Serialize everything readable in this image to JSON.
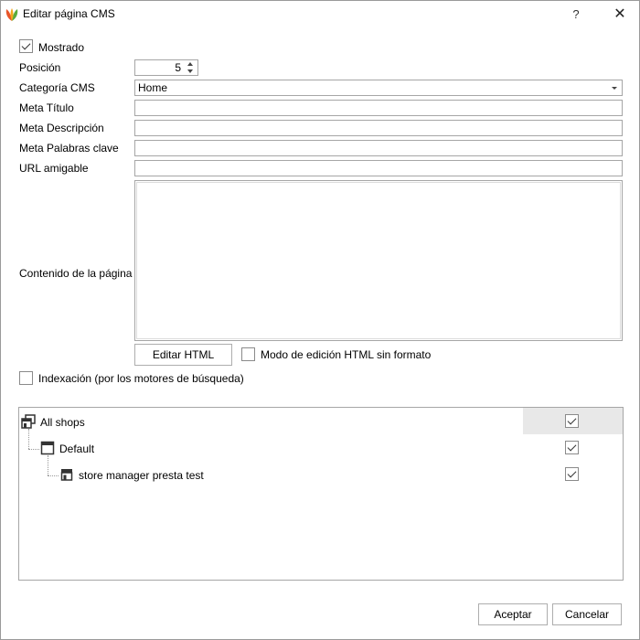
{
  "window": {
    "title": "Editar página CMS",
    "help_label": "?",
    "close_label": "✕"
  },
  "form": {
    "shown": {
      "label": "Mostrado",
      "checked": true
    },
    "position": {
      "label": "Posición",
      "value": "5"
    },
    "category": {
      "label": "Categoría CMS",
      "value": "Home"
    },
    "meta_title": {
      "label": "Meta Título",
      "value": ""
    },
    "meta_description": {
      "label": "Meta Descripción",
      "value": ""
    },
    "meta_keywords": {
      "label": "Meta Palabras clave",
      "value": ""
    },
    "friendly_url": {
      "label": "URL amigable",
      "value": ""
    },
    "content": {
      "label": "Contenido de la página",
      "value": ""
    },
    "edit_html_label": "Editar HTML",
    "raw_html_mode": {
      "label": "Modo de edición HTML sin formato",
      "checked": false
    },
    "indexation": {
      "label": "Indexación (por los motores de búsqueda)",
      "checked": false
    }
  },
  "shops_tree": [
    {
      "label": "All shops",
      "level": 0,
      "checked": true,
      "selected": true,
      "icon": "shop-group-icon"
    },
    {
      "label": "Default",
      "level": 1,
      "checked": true,
      "selected": false,
      "icon": "window-icon"
    },
    {
      "label": "store manager presta test",
      "level": 2,
      "checked": true,
      "selected": false,
      "icon": "store-icon"
    }
  ],
  "footer": {
    "accept_label": "Aceptar",
    "cancel_label": "Cancelar"
  },
  "colors": {
    "icon_dark": "#333333",
    "selection": "#e8e8e8",
    "border": "#a6a6a6"
  }
}
